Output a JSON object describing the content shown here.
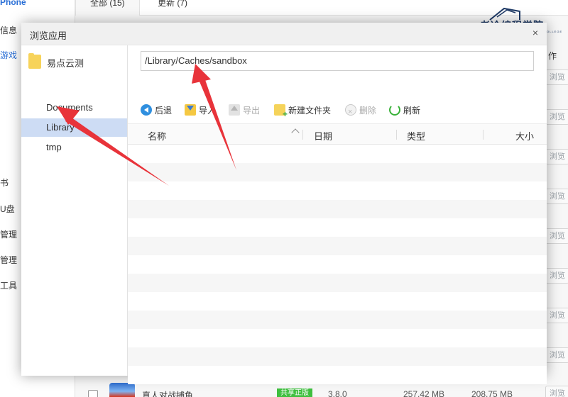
{
  "background": {
    "sidebar": {
      "device": "Phone",
      "items": [
        "信息",
        "游戏",
        "书",
        "U盘",
        "管理",
        "管理",
        "工具"
      ]
    },
    "tabs": [
      {
        "label": "全部 (15)"
      },
      {
        "label": "更新 (7)"
      }
    ],
    "operation_header": "作",
    "browse_label": "浏览",
    "footer_app": {
      "name": "真人对战捕鱼",
      "badge": "共享正版",
      "version": "3.8.0",
      "size1": "257.42 MB",
      "size2": "208.75 MB"
    }
  },
  "watermark": {
    "text": "老冷编程学院",
    "sub": "LAOLENG PROGRAMMING COLLEGE"
  },
  "dialog": {
    "title": "浏览应用",
    "close": "×",
    "app_name": "易点云测",
    "tree": [
      {
        "label": "Documents",
        "selected": false
      },
      {
        "label": "Library",
        "selected": true
      },
      {
        "label": "tmp",
        "selected": false
      }
    ],
    "path": "/Library/Caches/sandbox",
    "toolbar": {
      "back": "后退",
      "import": "导入",
      "export": "导出",
      "new_folder": "新建文件夹",
      "delete": "删除",
      "refresh": "刷新"
    },
    "columns": {
      "name": "名称",
      "date": "日期",
      "type": "类型",
      "size": "大小"
    }
  },
  "colors": {
    "selected_row": "#cddcf4",
    "annotation_arrow": "#e8333a",
    "refresh_green": "#39b139",
    "back_blue": "#2f8fdf"
  }
}
